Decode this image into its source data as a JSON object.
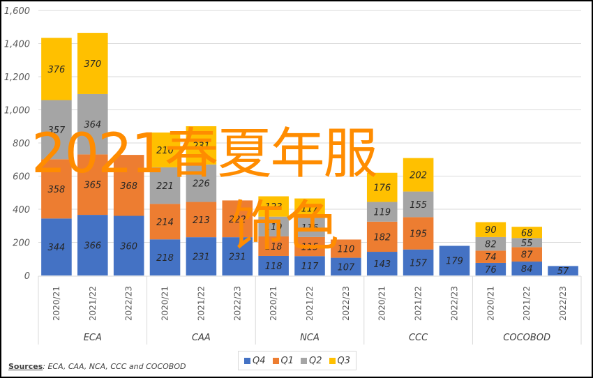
{
  "chart_data": {
    "type": "bar",
    "stacked": true,
    "title": "",
    "xlabel": "",
    "ylabel": "",
    "ylim": [
      0,
      1600
    ],
    "yticks": [
      0,
      200,
      400,
      600,
      800,
      1000,
      1200,
      1400,
      1600
    ],
    "ytick_labels": [
      "0",
      "200",
      "400",
      "600",
      "800",
      "1,000",
      "1,200",
      "1,400",
      "1,600"
    ],
    "grid": true,
    "legend_position": "bottom",
    "groups": [
      {
        "name": "ECA",
        "categories": [
          "2020/21",
          "2021/22",
          "2022/23"
        ]
      },
      {
        "name": "CAA",
        "categories": [
          "2020/21",
          "2021/22",
          "2022/23"
        ]
      },
      {
        "name": "NCA",
        "categories": [
          "2020/21",
          "2021/22",
          "2022/23"
        ]
      },
      {
        "name": "CCC",
        "categories": [
          "2020/21",
          "2021/22",
          "2022/23"
        ]
      },
      {
        "name": "COCOBOD",
        "categories": [
          "2020/21",
          "2021/22",
          "2022/23"
        ]
      }
    ],
    "series": [
      {
        "name": "Q4",
        "color": "#4472c4",
        "values": [
          344,
          366,
          360,
          218,
          231,
          231,
          118,
          117,
          107,
          143,
          157,
          179,
          76,
          84,
          57
        ]
      },
      {
        "name": "Q1",
        "color": "#ed7d31",
        "values": [
          358,
          365,
          368,
          214,
          213,
          222,
          118,
          115,
          110,
          182,
          195,
          null,
          74,
          87,
          null
        ]
      },
      {
        "name": "Q2",
        "color": "#a5a5a5",
        "values": [
          357,
          364,
          null,
          221,
          226,
          null,
          119,
          116,
          null,
          119,
          155,
          null,
          82,
          55,
          null
        ]
      },
      {
        "name": "Q3",
        "color": "#ffc000",
        "values": [
          376,
          370,
          null,
          210,
          231,
          null,
          123,
          117,
          null,
          176,
          202,
          null,
          90,
          68,
          null
        ]
      }
    ]
  },
  "legend": {
    "items": [
      {
        "label": "Q4",
        "color": "#4472c4"
      },
      {
        "label": "Q1",
        "color": "#ed7d31"
      },
      {
        "label": "Q2",
        "color": "#a5a5a5"
      },
      {
        "label": "Q3",
        "color": "#ffc000"
      }
    ]
  },
  "source": {
    "key": "Sources",
    "text": ": ECA, CAA, NCA, CCC and COCOBOD"
  },
  "overlay": {
    "line1": "2021春夏年服",
    "line2": "饰色",
    "color": "#ff8c00"
  }
}
